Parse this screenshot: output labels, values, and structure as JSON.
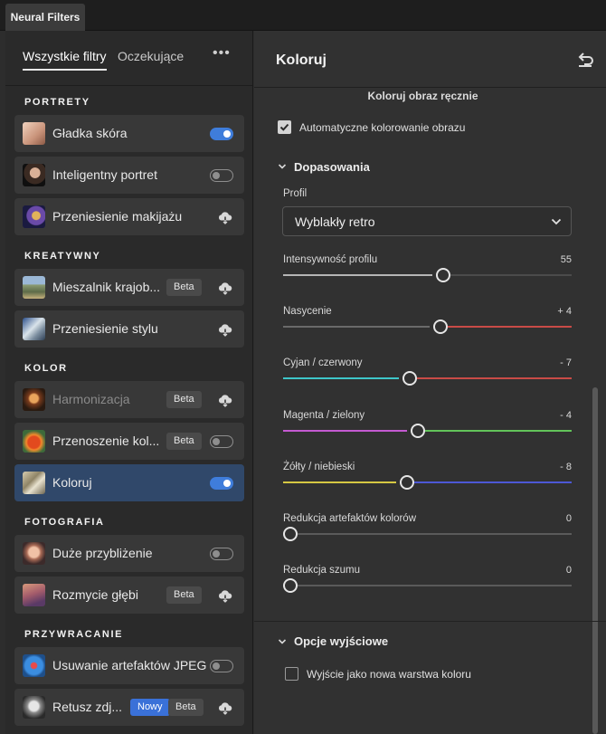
{
  "window": {
    "tab_label": "Neural Filters"
  },
  "left": {
    "tabs": [
      {
        "label": "Wszystkie filtry"
      },
      {
        "label": "Oczekujące"
      }
    ],
    "more_label": "•••",
    "sections": [
      {
        "label": "PORTRETY"
      },
      {
        "label": "KREATYWNY"
      },
      {
        "label": "KOLOR"
      },
      {
        "label": "FOTOGRAFIA"
      },
      {
        "label": "PRZYWRACANIE"
      }
    ],
    "items": [
      {
        "label": "Gładka skóra",
        "control": "toggle",
        "on": true
      },
      {
        "label": "Inteligentny portret",
        "control": "toggle",
        "on": false
      },
      {
        "label": "Przeniesienie makijażu",
        "control": "cloud-download-icon"
      },
      {
        "label": "Mieszalnik krajob...",
        "badge": "Beta",
        "control": "cloud-download-icon"
      },
      {
        "label": "Przeniesienie stylu",
        "control": "cloud-download-icon"
      },
      {
        "label": "Harmonizacja",
        "badge": "Beta",
        "control": "cloud-download-icon",
        "disabled": true
      },
      {
        "label": "Przenoszenie kol...",
        "badge": "Beta",
        "control": "toggle",
        "on": false
      },
      {
        "label": "Koloruj",
        "control": "toggle",
        "on": true,
        "selected": true
      },
      {
        "label": "Duże przybliżenie",
        "control": "toggle",
        "on": false
      },
      {
        "label": "Rozmycie głębi",
        "badge": "Beta",
        "control": "cloud-download-icon"
      },
      {
        "label": "Usuwanie artefaktów JPEG",
        "control": "toggle",
        "on": false
      },
      {
        "label": "Retusz zdj...",
        "badge_new": "Nowy",
        "badge": "Beta",
        "control": "cloud-download-icon"
      }
    ]
  },
  "right": {
    "title": "Koloruj",
    "subtitle": "Koloruj obraz ręcznie",
    "auto_color": {
      "label": "Automatyczne kolorowanie obrazu",
      "checked": true
    },
    "adjustments": {
      "title": "Dopasowania",
      "profile_label": "Profil",
      "profile_value": "Wyblakły retro",
      "sliders": [
        {
          "label": "Intensywność profilu",
          "value": "55",
          "position": 0.55,
          "colors": [
            "#b5b5b5",
            "#4b4b4b"
          ]
        },
        {
          "label": "Nasycenie",
          "value": "+ 4",
          "position": 0.54,
          "colors": [
            "#6a6a6a",
            "#c94b47"
          ]
        },
        {
          "label": "Cyjan / czerwony",
          "value": "- 7",
          "position": 0.43,
          "colors": [
            "#3ec6c9",
            "#c94b47"
          ]
        },
        {
          "label": "Magenta / zielony",
          "value": "- 4",
          "position": 0.46,
          "colors": [
            "#c45ad1",
            "#62c45a"
          ]
        },
        {
          "label": "Żółty / niebieski",
          "value": "- 8",
          "position": 0.42,
          "colors": [
            "#d6c843",
            "#4d58d6"
          ]
        },
        {
          "label": "Redukcja artefaktów kolorów",
          "value": "0",
          "position": 0.0,
          "colors": [
            "#5a5a5a",
            "#5a5a5a"
          ]
        },
        {
          "label": "Redukcja szumu",
          "value": "0",
          "position": 0.0,
          "colors": [
            "#5a5a5a",
            "#5a5a5a"
          ]
        }
      ]
    },
    "output": {
      "title": "Opcje wyjściowe",
      "new_layer": {
        "label": "Wyjście jako nowa warstwa koloru",
        "checked": false
      }
    }
  }
}
